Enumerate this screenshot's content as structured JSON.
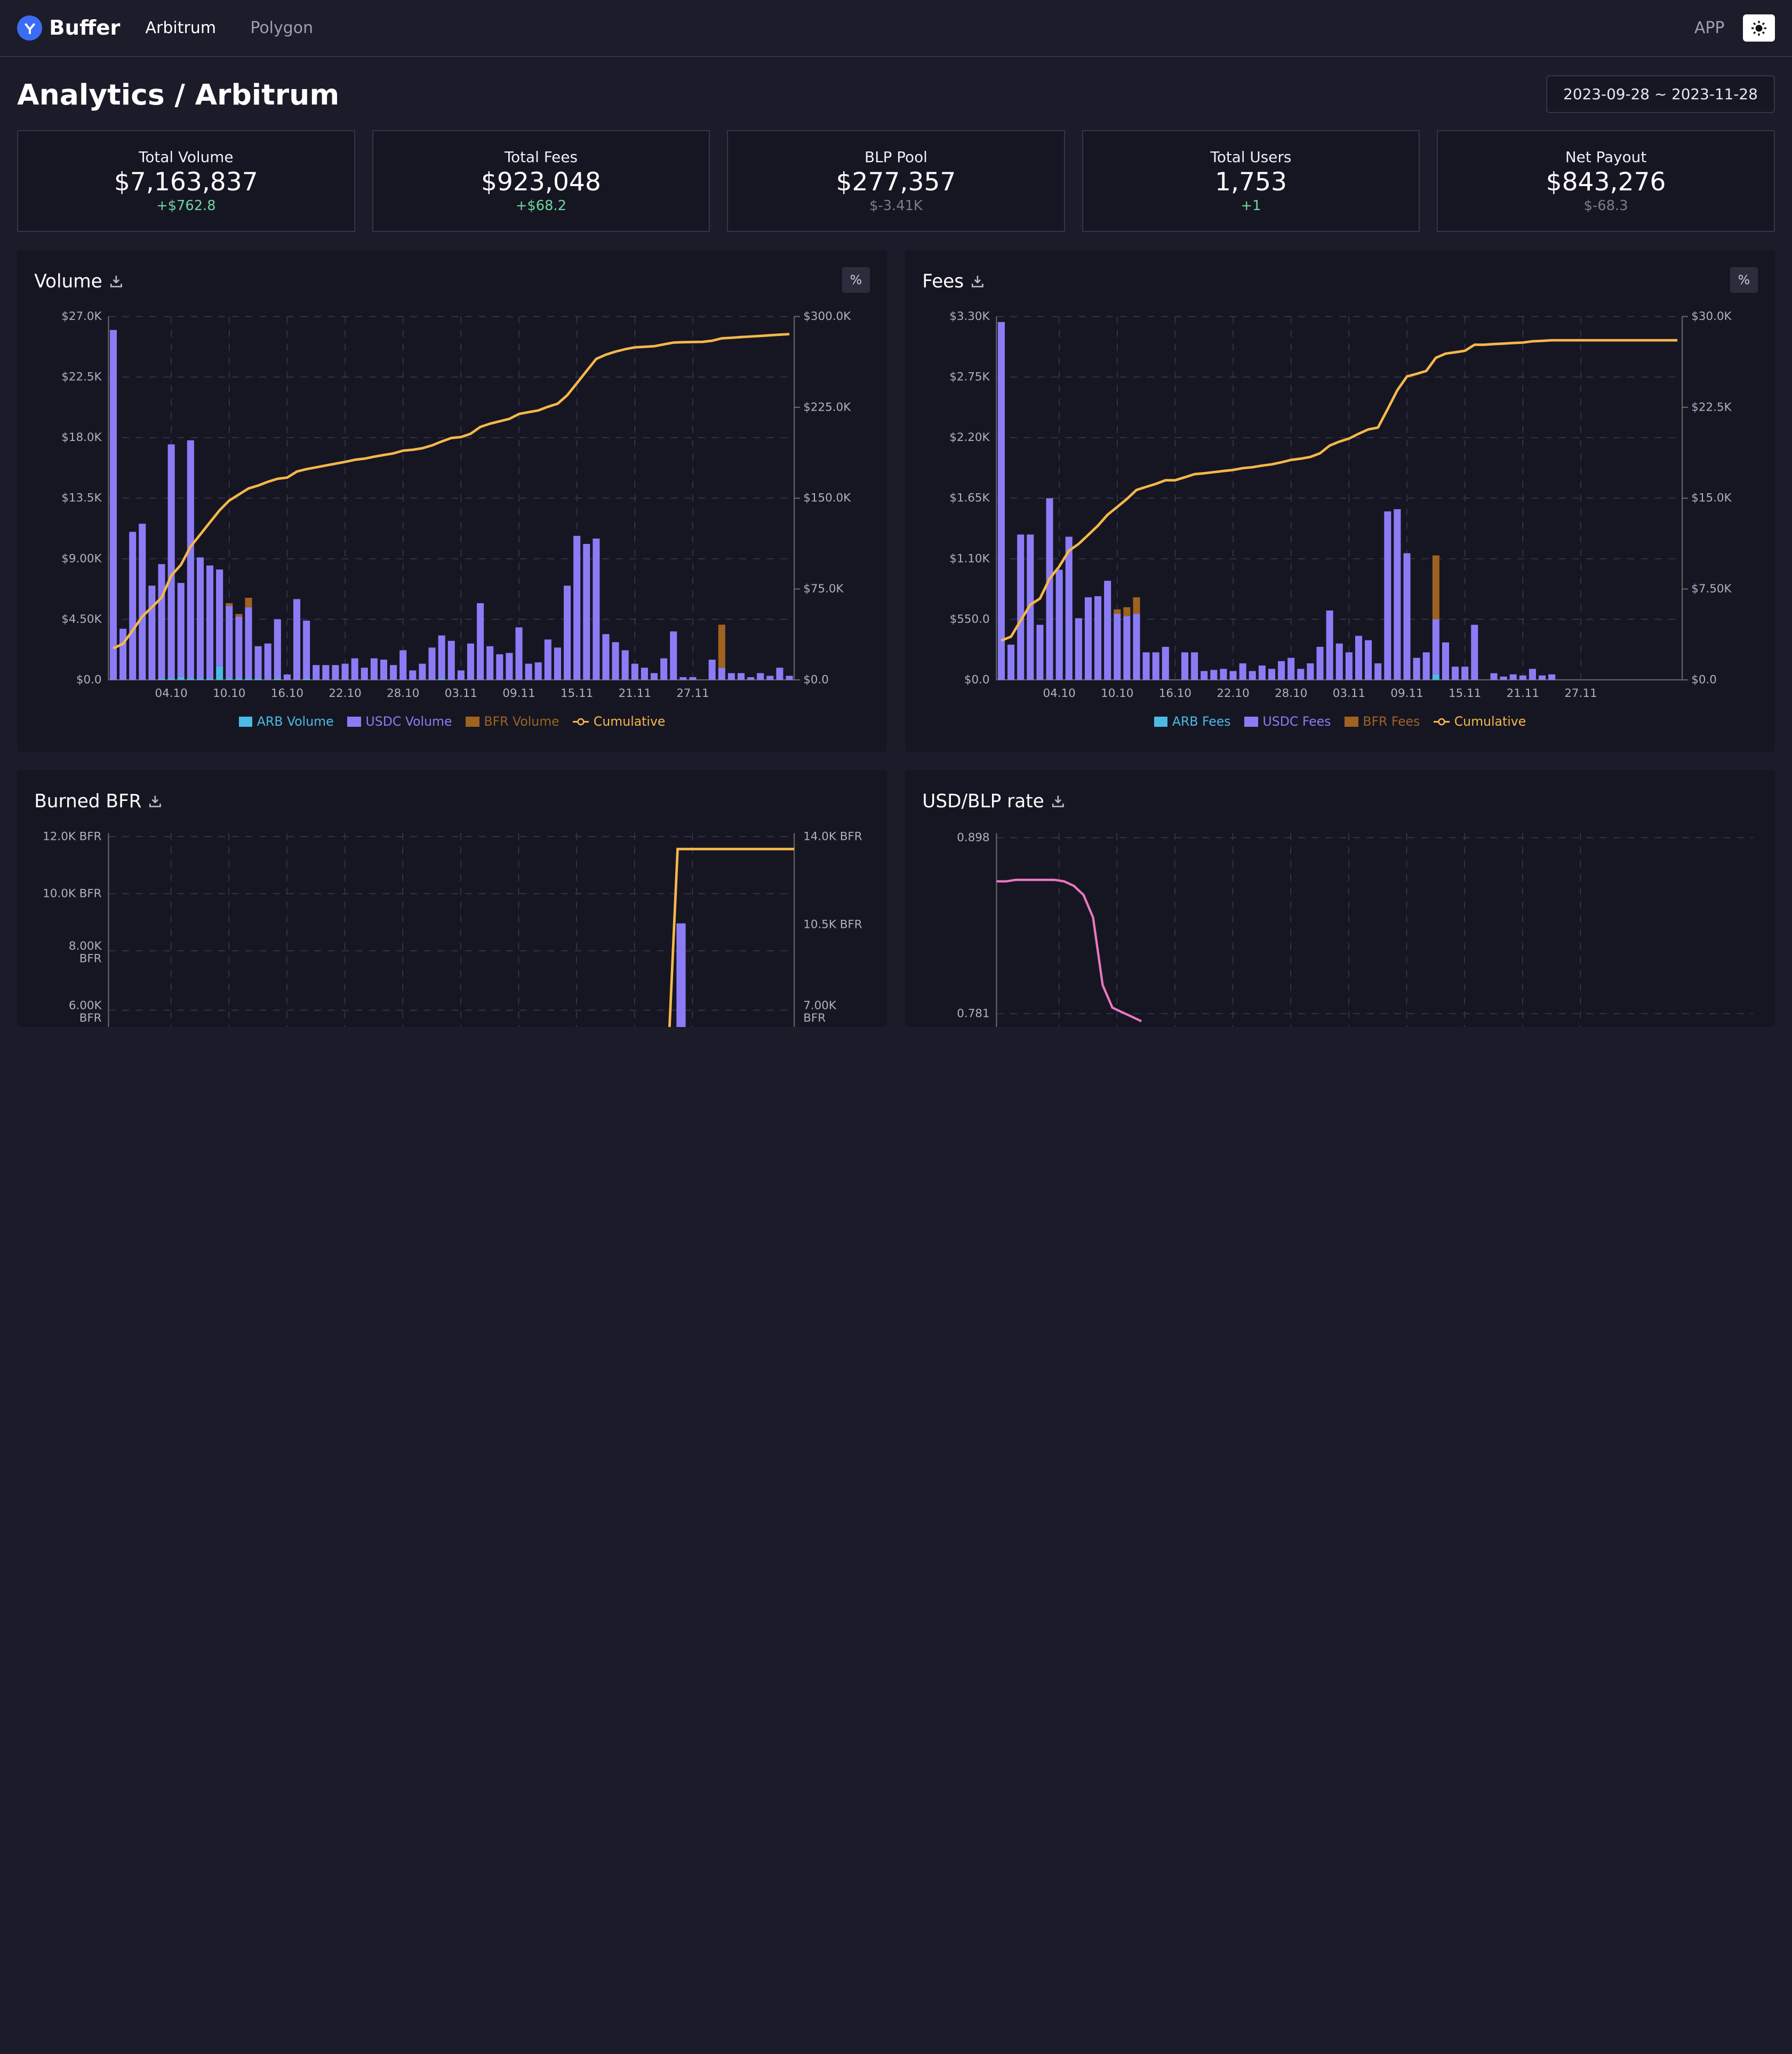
{
  "brand": {
    "name": "Buffer"
  },
  "nav": {
    "items": [
      {
        "label": "Arbitrum",
        "active": true
      },
      {
        "label": "Polygon",
        "active": false
      }
    ],
    "app_label": "APP"
  },
  "page": {
    "title": "Analytics / Arbitrum",
    "date_range": "2023-09-28 ~ 2023-11-28"
  },
  "stats": [
    {
      "label": "Total Volume",
      "value": "$7,163,837",
      "delta": "+$762.8",
      "delta_kind": "pos"
    },
    {
      "label": "Total Fees",
      "value": "$923,048",
      "delta": "+$68.2",
      "delta_kind": "pos"
    },
    {
      "label": "BLP Pool",
      "value": "$277,357",
      "delta": "$-3.41K",
      "delta_kind": "neu"
    },
    {
      "label": "Total Users",
      "value": "1,753",
      "delta": "+1",
      "delta_kind": "pos"
    },
    {
      "label": "Net Payout",
      "value": "$843,276",
      "delta": "$-68.3",
      "delta_kind": "neu"
    }
  ],
  "colors": {
    "arb": "#4bbbe6",
    "usdc": "#8b7cf6",
    "bfr": "#a0621f",
    "cumulative": "#f5b84a",
    "rate": "#e978c0",
    "grid": "#3a3a50",
    "axis_text": "#b0b0c0"
  },
  "panels": {
    "volume": {
      "title": "Volume",
      "pct_label": "%",
      "legend": [
        "ARB Volume",
        "USDC Volume",
        "BFR Volume",
        "Cumulative"
      ]
    },
    "fees": {
      "title": "Fees",
      "pct_label": "%",
      "legend": [
        "ARB Fees",
        "USDC Fees",
        "BFR Fees",
        "Cumulative"
      ]
    },
    "burned": {
      "title": "Burned BFR"
    },
    "rate": {
      "title": "USD/BLP rate"
    }
  },
  "chart_data": [
    {
      "type": "bar",
      "id": "volume",
      "title": "Volume",
      "x_ticks": [
        "04.10",
        "10.10",
        "16.10",
        "22.10",
        "28.10",
        "03.11",
        "09.11",
        "15.11",
        "21.11",
        "27.11"
      ],
      "y_ticks_left": [
        "$0.0",
        "$4.50K",
        "$9.00K",
        "$13.5K",
        "$18.0K",
        "$22.5K",
        "$27.0K"
      ],
      "y_ticks_right": [
        "$0.0",
        "$75.0K",
        "$150.0K",
        "$225.0K",
        "$300.0K"
      ],
      "ylim_left": [
        0,
        27000
      ],
      "ylim_right": [
        0,
        300000
      ],
      "series": [
        {
          "name": "ARB Volume",
          "values": [
            0,
            0,
            0,
            0,
            0,
            100,
            100,
            200,
            100,
            100,
            100,
            1000,
            100,
            100,
            100,
            100,
            0,
            100,
            0,
            0,
            100,
            0,
            0,
            0,
            0,
            0,
            0,
            0,
            0,
            0,
            0,
            0,
            0,
            0,
            100,
            0,
            0,
            0,
            0,
            0,
            0,
            0,
            0,
            0,
            0,
            0,
            0,
            0,
            0,
            0,
            0,
            0,
            0,
            0,
            0,
            0,
            0,
            0,
            0,
            0,
            0,
            0,
            0,
            0,
            0,
            0,
            0,
            0,
            0,
            0,
            0
          ]
        },
        {
          "name": "USDC Volume",
          "values": [
            26000,
            3800,
            11000,
            11600,
            7000,
            8500,
            17400,
            7000,
            17700,
            9000,
            8400,
            7200,
            5400,
            4600,
            5300,
            2400,
            2700,
            4400,
            400,
            6000,
            4300,
            1100,
            1100,
            1100,
            1200,
            1600,
            900,
            1600,
            1500,
            1100,
            2200,
            700,
            1200,
            2400,
            3200,
            2900,
            700,
            2700,
            5700,
            2500,
            1900,
            2000,
            3900,
            1200,
            1300,
            3000,
            2400,
            7000,
            10700,
            10100,
            10500,
            3400,
            2800,
            2200,
            1200,
            900,
            500,
            1600,
            3600,
            200,
            200,
            0,
            1500,
            900,
            500,
            500,
            200,
            500,
            300,
            900,
            300
          ]
        },
        {
          "name": "BFR Volume",
          "values": [
            0,
            0,
            0,
            0,
            0,
            0,
            0,
            0,
            0,
            0,
            0,
            0,
            200,
            200,
            700,
            0,
            0,
            0,
            0,
            0,
            0,
            0,
            0,
            0,
            0,
            0,
            0,
            0,
            0,
            0,
            0,
            0,
            0,
            0,
            0,
            0,
            0,
            0,
            0,
            0,
            0,
            0,
            0,
            0,
            0,
            0,
            0,
            0,
            0,
            0,
            0,
            0,
            0,
            0,
            0,
            0,
            0,
            0,
            0,
            0,
            0,
            0,
            0,
            3200,
            0,
            0,
            0,
            0,
            0,
            0,
            0
          ]
        },
        {
          "name": "Cumulative",
          "values": [
            26000,
            29800,
            40800,
            52400,
            60000,
            68000,
            86000,
            95000,
            110000,
            120000,
            130000,
            140000,
            148000,
            153000,
            158000,
            160500,
            163500,
            166000,
            167000,
            172000,
            174000,
            175500,
            177000,
            178500,
            180000,
            181700,
            182600,
            184200,
            185700,
            187000,
            189200,
            190000,
            191200,
            193600,
            196800,
            199700,
            200500,
            203200,
            208900,
            211500,
            213500,
            215500,
            219500,
            221000,
            222500,
            225500,
            228000,
            235000,
            245000,
            255000,
            265000,
            268500,
            271000,
            273000,
            274500,
            275000,
            275500,
            277000,
            278500,
            278800,
            279000,
            279100,
            280000,
            282000,
            282500,
            283000,
            283500,
            284000,
            284500,
            285000,
            285500
          ]
        }
      ]
    },
    {
      "type": "bar",
      "id": "fees",
      "title": "Fees",
      "x_ticks": [
        "04.10",
        "10.10",
        "16.10",
        "22.10",
        "28.10",
        "03.11",
        "09.11",
        "15.11",
        "21.11",
        "27.11"
      ],
      "y_ticks_left": [
        "$0.0",
        "$550.0",
        "$1.10K",
        "$1.65K",
        "$2.20K",
        "$2.75K",
        "$3.30K"
      ],
      "y_ticks_right": [
        "$0.0",
        "$7.50K",
        "$15.0K",
        "$22.5K",
        "$30.0K"
      ],
      "ylim_left": [
        0,
        3300
      ],
      "ylim_right": [
        0,
        30000
      ],
      "series": [
        {
          "name": "ARB Fees",
          "values": [
            0,
            0,
            0,
            0,
            0,
            0,
            0,
            0,
            0,
            0,
            0,
            0,
            0,
            0,
            0,
            0,
            0,
            0,
            0,
            0,
            0,
            0,
            0,
            0,
            0,
            0,
            0,
            0,
            0,
            0,
            0,
            0,
            0,
            0,
            0,
            0,
            0,
            0,
            0,
            0,
            0,
            0,
            0,
            0,
            0,
            50,
            0,
            0,
            0,
            0,
            0,
            0,
            0,
            0,
            0,
            0,
            0,
            0,
            0,
            0,
            0,
            0,
            0,
            0,
            0,
            0,
            0,
            0,
            0,
            0,
            0
          ]
        },
        {
          "name": "USDC Fees",
          "values": [
            3250,
            320,
            1320,
            1320,
            500,
            1650,
            1000,
            1300,
            560,
            750,
            760,
            900,
            600,
            580,
            600,
            250,
            250,
            300,
            0,
            250,
            250,
            80,
            90,
            100,
            80,
            150,
            80,
            130,
            100,
            170,
            200,
            100,
            150,
            300,
            630,
            330,
            250,
            400,
            360,
            150,
            1530,
            1550,
            1150,
            200,
            250,
            500,
            340,
            120,
            120,
            500,
            0,
            60,
            30,
            50,
            40,
            100,
            40,
            50,
            0,
            0,
            0,
            0,
            0,
            0,
            0,
            0,
            0,
            0,
            0,
            0,
            0
          ]
        },
        {
          "name": "BFR Fees",
          "values": [
            0,
            0,
            0,
            0,
            0,
            0,
            0,
            0,
            0,
            0,
            0,
            0,
            40,
            80,
            150,
            0,
            0,
            0,
            0,
            0,
            0,
            0,
            0,
            0,
            0,
            0,
            0,
            0,
            0,
            0,
            0,
            0,
            0,
            0,
            0,
            0,
            0,
            0,
            0,
            0,
            0,
            0,
            0,
            0,
            0,
            580,
            0,
            0,
            0,
            0,
            0,
            0,
            0,
            0,
            0,
            0,
            0,
            0,
            0,
            0,
            0,
            0,
            0,
            0,
            0,
            0,
            0,
            0,
            0,
            0,
            0
          ]
        },
        {
          "name": "Cumulative",
          "values": [
            3250,
            3570,
            4890,
            6210,
            6710,
            8360,
            9360,
            10660,
            11220,
            11970,
            12730,
            13630,
            14270,
            14930,
            15680,
            15930,
            16180,
            16480,
            16480,
            16730,
            16980,
            17060,
            17150,
            17250,
            17330,
            17480,
            17560,
            17690,
            17790,
            17960,
            18160,
            18260,
            18410,
            18710,
            19340,
            19670,
            19920,
            20320,
            20680,
            20830,
            22360,
            23910,
            25060,
            25260,
            25510,
            26590,
            26930,
            27050,
            27170,
            27670,
            27670,
            27730,
            27760,
            27810,
            27850,
            27950,
            27990,
            28040,
            28040,
            28040,
            28040,
            28040,
            28040,
            28040,
            28040,
            28040,
            28040,
            28040,
            28040,
            28040,
            28040
          ]
        }
      ]
    },
    {
      "type": "bar",
      "id": "burned",
      "title": "Burned BFR",
      "y_ticks_left": [
        "6.00K BFR",
        "8.00K BFR",
        "10.0K BFR",
        "12.0K BFR"
      ],
      "y_ticks_right": [
        "7.00K BFR",
        "10.5K BFR",
        "14.0K BFR"
      ],
      "ylim_left": [
        0,
        12000
      ],
      "ylim_right": [
        0,
        14000
      ],
      "series": [
        {
          "name": "Burned",
          "values": [
            9000
          ]
        },
        {
          "name": "Cumulative",
          "values": [
            13500
          ]
        }
      ]
    },
    {
      "type": "line",
      "id": "rate",
      "title": "USD/BLP rate",
      "y_ticks": [
        "0.781",
        "0.898"
      ],
      "ylim": [
        0.76,
        0.898
      ],
      "series": [
        {
          "name": "USD/BLP rate",
          "values": [
            0.869,
            0.869,
            0.87,
            0.87,
            0.87,
            0.87,
            0.87,
            0.869,
            0.866,
            0.86,
            0.845,
            0.8,
            0.785,
            0.782,
            0.779,
            0.776
          ]
        }
      ]
    }
  ]
}
